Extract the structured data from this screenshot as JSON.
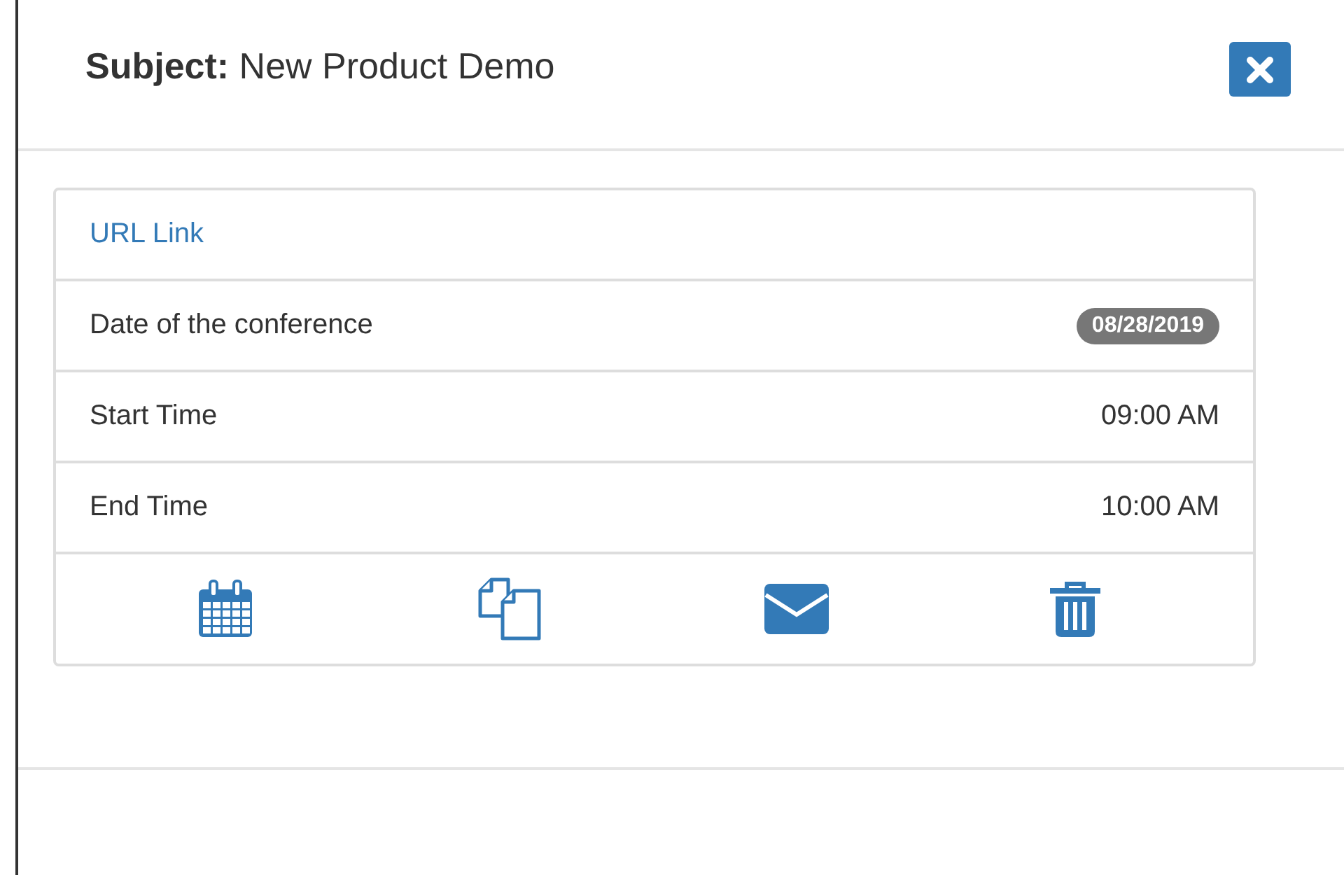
{
  "header": {
    "label": "Subject:",
    "value": "New Product Demo"
  },
  "rows": [
    {
      "kind": "link",
      "label": "URL Link"
    },
    {
      "kind": "badge",
      "label": "Date of the conference",
      "value": "08/28/2019"
    },
    {
      "kind": "text",
      "label": "Start Time",
      "value": "09:00 AM"
    },
    {
      "kind": "text",
      "label": "End Time",
      "value": "10:00 AM"
    }
  ]
}
